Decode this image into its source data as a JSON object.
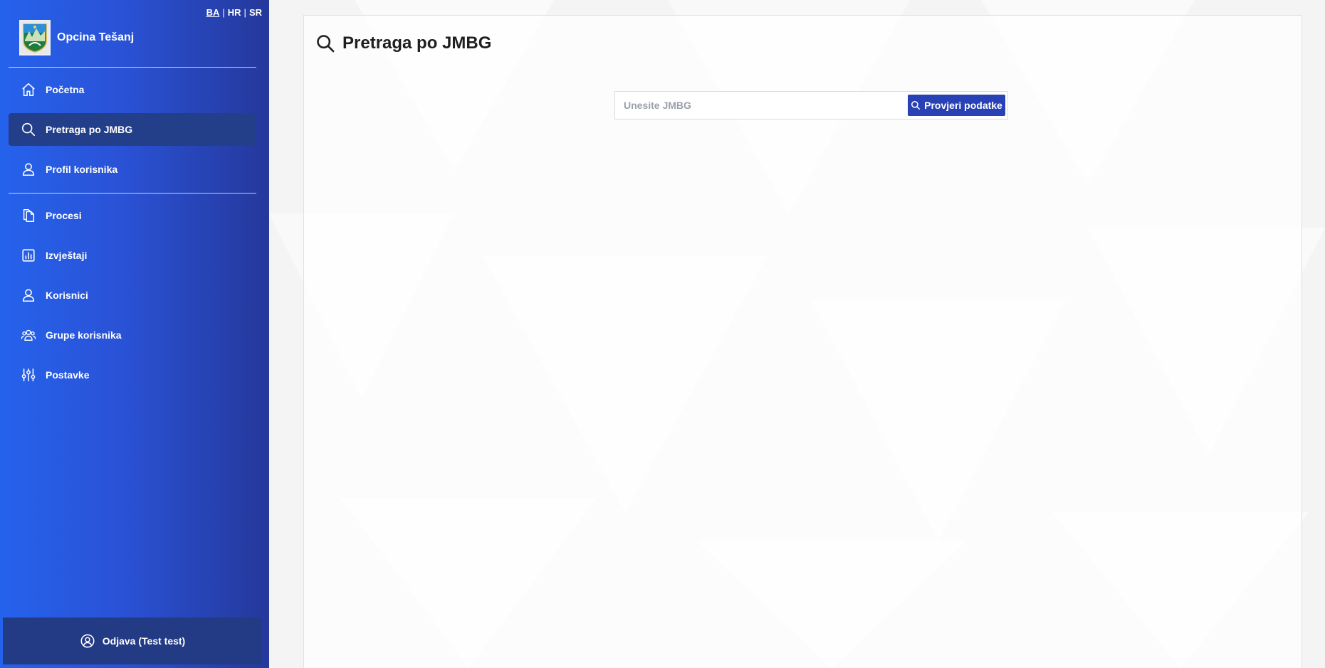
{
  "languages": [
    {
      "code": "BA",
      "active": true
    },
    {
      "code": "HR",
      "active": false
    },
    {
      "code": "SR",
      "active": false
    }
  ],
  "language_separator": "|",
  "brand": {
    "name": "Opcina Tešanj",
    "logo_icon": "municipality-coat-of-arms"
  },
  "nav": {
    "items": [
      {
        "label": "Početna",
        "icon": "home-icon",
        "active": false
      },
      {
        "label": "Pretraga po JMBG",
        "icon": "search-icon",
        "active": true
      },
      {
        "label": "Profil korisnika",
        "icon": "user-icon",
        "active": false
      },
      {
        "label": "Procesi",
        "icon": "copy-icon",
        "active": false
      },
      {
        "label": "Izvještaji",
        "icon": "chart-icon",
        "active": false
      },
      {
        "label": "Korisnici",
        "icon": "user-icon",
        "active": false
      },
      {
        "label": "Grupe korisnika",
        "icon": "users-group-icon",
        "active": false
      },
      {
        "label": "Postavke",
        "icon": "sliders-icon",
        "active": false
      }
    ]
  },
  "logout": {
    "label": "Odjava (Test test)",
    "icon": "user-circle-icon"
  },
  "page": {
    "title": "Pretraga po JMBG",
    "title_icon": "search-icon"
  },
  "search": {
    "placeholder": "Unesite JMBG",
    "value": "",
    "button_label": "Provjeri podatke"
  },
  "colors": {
    "sidebar_gradient_start": "#2562ec",
    "sidebar_gradient_end": "#25389b",
    "active_item": "#233f8a",
    "logout_bg": "#233a85",
    "button_bg": "#2841b4"
  }
}
